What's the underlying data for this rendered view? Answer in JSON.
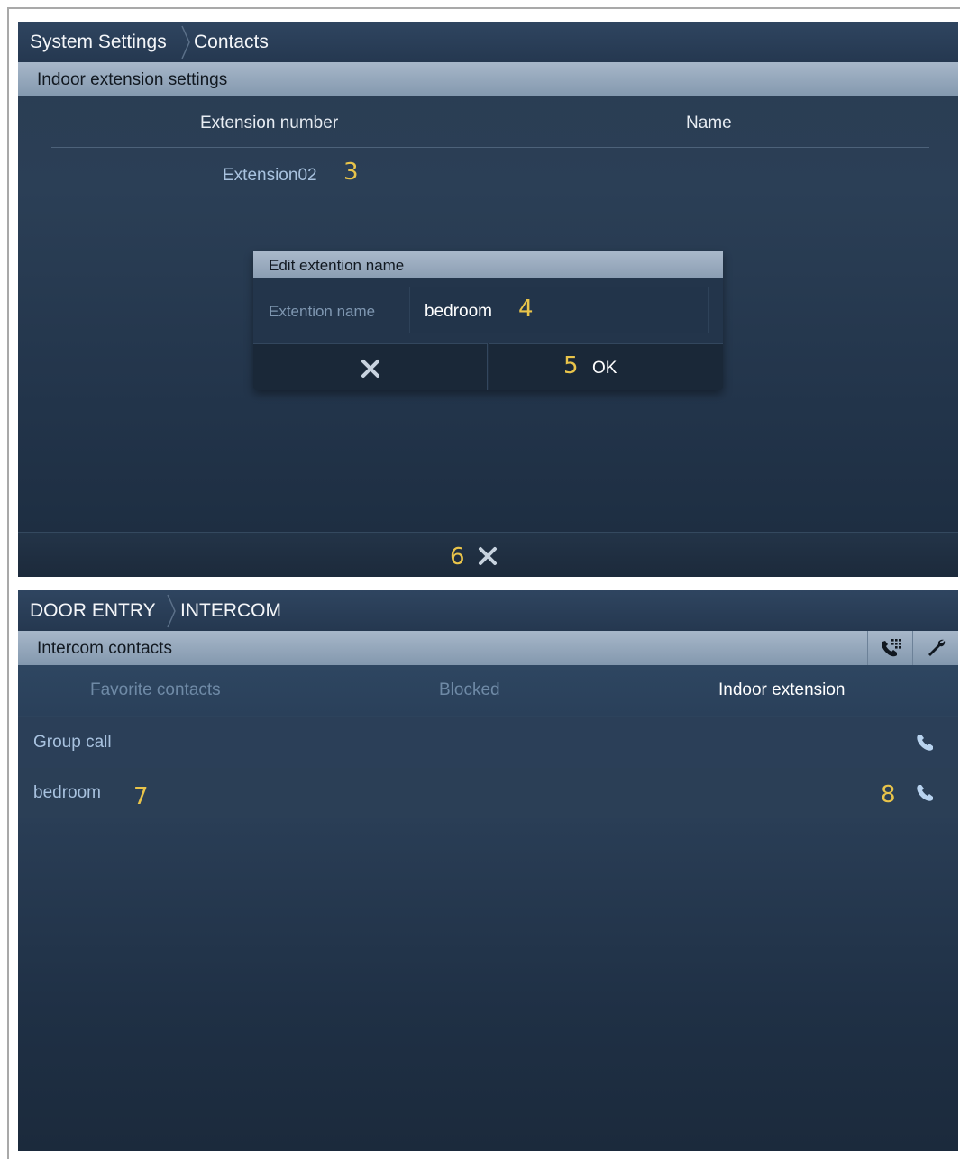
{
  "screen1": {
    "breadcrumb": [
      "System Settings",
      "Contacts"
    ],
    "section_title": "Indoor extension settings",
    "columns": [
      "Extension number",
      "Name"
    ],
    "rows": [
      {
        "extension": "Extension02",
        "name": ""
      }
    ],
    "dialog": {
      "title": "Edit extention name",
      "field_label": "Extention name",
      "field_value": "bedroom",
      "ok_label": "OK"
    },
    "markers": {
      "row": "3",
      "field": "4",
      "ok": "5",
      "close": "6"
    }
  },
  "screen2": {
    "breadcrumb": [
      "DOOR ENTRY",
      "INTERCOM"
    ],
    "section_title": "Intercom contacts",
    "tabs": [
      {
        "label": "Favorite contacts",
        "active": false
      },
      {
        "label": "Blocked",
        "active": false
      },
      {
        "label": "Indoor extension",
        "active": true
      }
    ],
    "list": [
      {
        "label": "Group call"
      },
      {
        "label": "bedroom"
      }
    ],
    "markers": {
      "row": "7",
      "call": "8"
    }
  },
  "colors": {
    "accent_marker": "#e9c44a",
    "header_bar": "#97a9bd",
    "text_muted": "#a8c2df",
    "call_icon": "#b8d3ef"
  },
  "icons": [
    "close-icon",
    "phone-keypad-icon",
    "wrench-icon",
    "phone-icon"
  ]
}
